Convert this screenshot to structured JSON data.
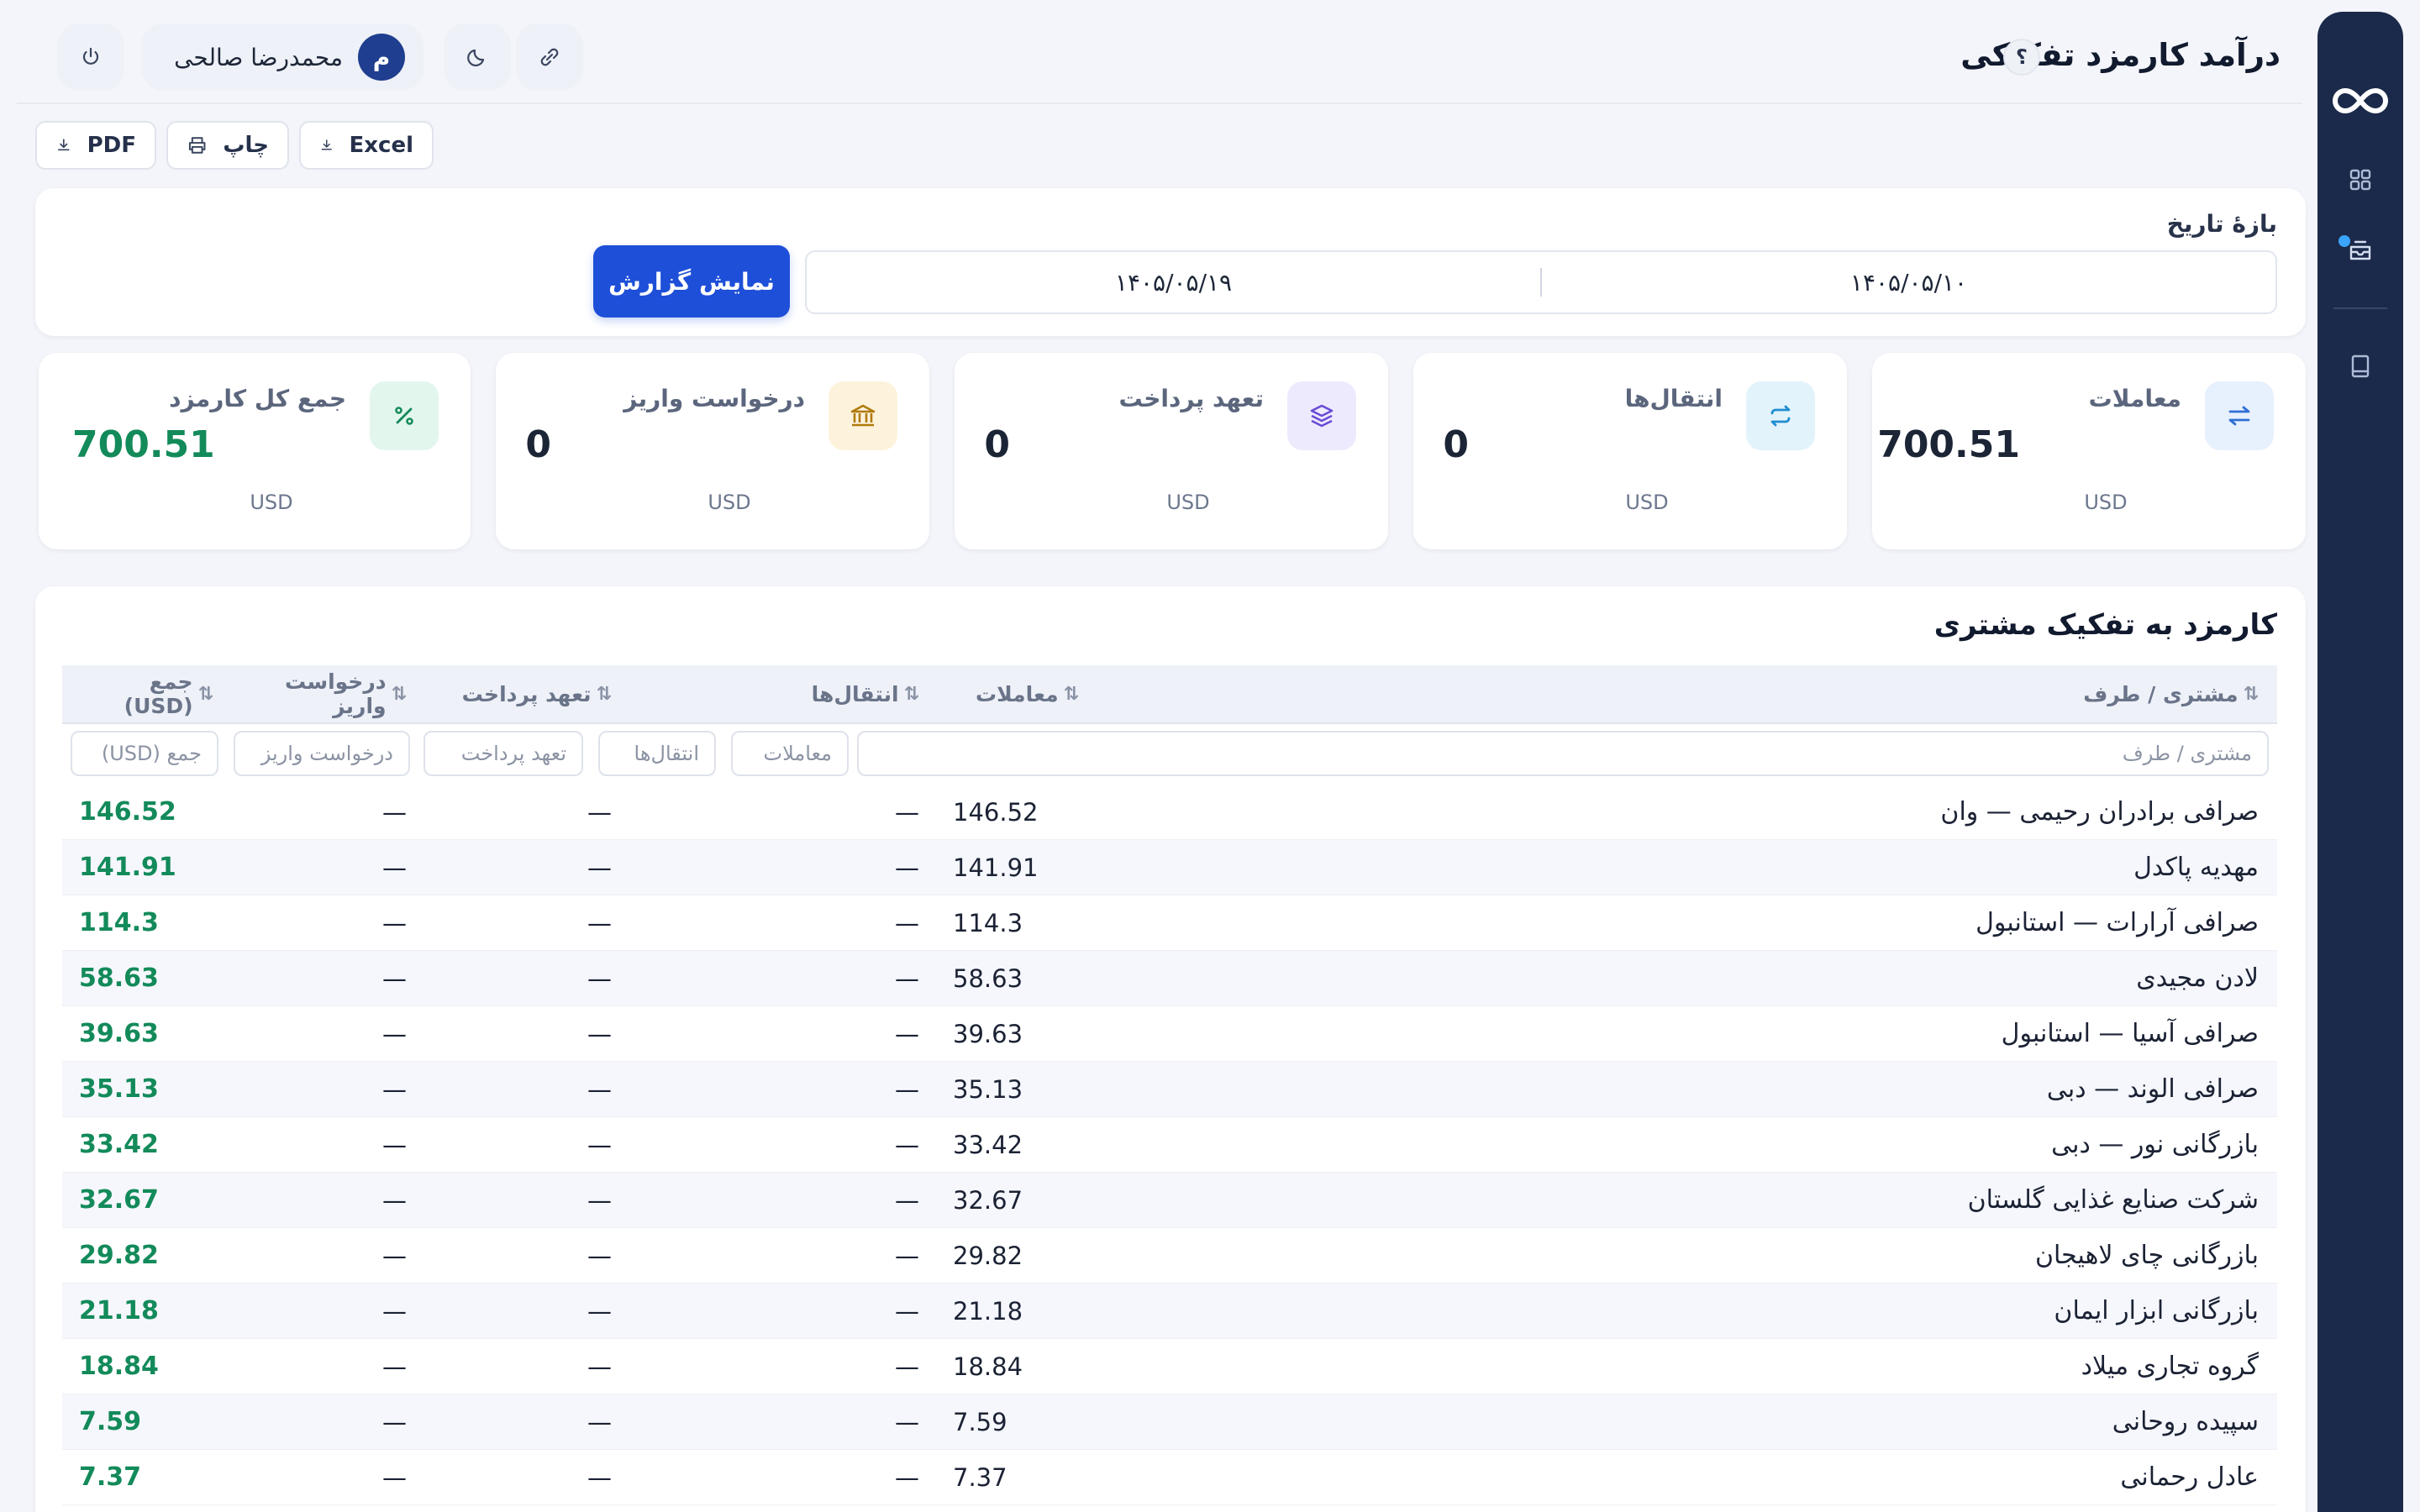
{
  "header": {
    "title": "درآمد کارمزد تفکیکی",
    "help_glyph": "؟",
    "user_initial": "م",
    "user_name": "محمدرضا صالحی"
  },
  "exports": {
    "excel": "Excel",
    "print": "چاپ",
    "pdf": "PDF"
  },
  "filter": {
    "label": "بازهٔ تاریخ",
    "date_from": "۱۴۰۵/۰۵/۱۰",
    "date_to": "۱۴۰۵/۰۵/۱۹",
    "submit_label": "نمایش گزارش"
  },
  "stats": [
    {
      "label": "معاملات",
      "value": "700.51",
      "unit": "USD",
      "icon": "swap-arrows-icon",
      "color": "#2f6fd6",
      "bg": "#e7f0fd"
    },
    {
      "label": "انتقال‌ها",
      "value": "0",
      "unit": "USD",
      "icon": "refresh-arrows-icon",
      "color": "#1f8ed0",
      "bg": "#e3f3fc"
    },
    {
      "label": "تعهد پرداخت",
      "value": "0",
      "unit": "USD",
      "icon": "layers-icon",
      "color": "#6a4bd6",
      "bg": "#eeeafd"
    },
    {
      "label": "درخواست واریز",
      "value": "0",
      "unit": "USD",
      "icon": "bank-icon",
      "color": "#b07a0b",
      "bg": "#fdf3dc"
    },
    {
      "label": "جمع کل کارمزد",
      "value": "700.51",
      "unit": "USD",
      "icon": "percent-icon",
      "color": "#138a5a",
      "bg": "#e2f6ed"
    }
  ],
  "table": {
    "title": "کارمزد به تفکیک مشتری",
    "columns": {
      "name": "مشتری / طرف",
      "transactions": "معاملات",
      "transfers": "انتقال‌ها",
      "commitments": "تعهد پرداخت",
      "deposits": "درخواست واریز",
      "total": "جمع (USD)"
    },
    "sort_glyph": "⇅",
    "filter_placeholders": {
      "name": "مشتری / طرف",
      "transactions": "معاملات",
      "transfers": "انتقال‌ها",
      "commitments": "تعهد پرداخت",
      "deposits": "درخواست واریز",
      "total": "جمع (USD)"
    },
    "rows": [
      {
        "name": "صرافی برادران رحیمی — وان",
        "transactions": "146.52",
        "transfers": "—",
        "commitments": "—",
        "deposits": "—",
        "total": "146.52"
      },
      {
        "name": "مهدیه پاکدل",
        "transactions": "141.91",
        "transfers": "—",
        "commitments": "—",
        "deposits": "—",
        "total": "141.91"
      },
      {
        "name": "صرافی آرارات — استانبول",
        "transactions": "114.3",
        "transfers": "—",
        "commitments": "—",
        "deposits": "—",
        "total": "114.3"
      },
      {
        "name": "لادن مجیدی",
        "transactions": "58.63",
        "transfers": "—",
        "commitments": "—",
        "deposits": "—",
        "total": "58.63"
      },
      {
        "name": "صرافی آسیا — استانبول",
        "transactions": "39.63",
        "transfers": "—",
        "commitments": "—",
        "deposits": "—",
        "total": "39.63"
      },
      {
        "name": "صرافی الوند — دبی",
        "transactions": "35.13",
        "transfers": "—",
        "commitments": "—",
        "deposits": "—",
        "total": "35.13"
      },
      {
        "name": "بازرگانی نور — دبی",
        "transactions": "33.42",
        "transfers": "—",
        "commitments": "—",
        "deposits": "—",
        "total": "33.42"
      },
      {
        "name": "شرکت صنایع غذایی گلستان",
        "transactions": "32.67",
        "transfers": "—",
        "commitments": "—",
        "deposits": "—",
        "total": "32.67"
      },
      {
        "name": "بازرگانی چای لاهیجان",
        "transactions": "29.82",
        "transfers": "—",
        "commitments": "—",
        "deposits": "—",
        "total": "29.82"
      },
      {
        "name": "بازرگانی ابزار ایمان",
        "transactions": "21.18",
        "transfers": "—",
        "commitments": "—",
        "deposits": "—",
        "total": "21.18"
      },
      {
        "name": "گروه تجاری میلاد",
        "transactions": "18.84",
        "transfers": "—",
        "commitments": "—",
        "deposits": "—",
        "total": "18.84"
      },
      {
        "name": "سپیده روحانی",
        "transactions": "7.59",
        "transfers": "—",
        "commitments": "—",
        "deposits": "—",
        "total": "7.59"
      },
      {
        "name": "عادل رحمانی",
        "transactions": "7.37",
        "transfers": "—",
        "commitments": "—",
        "deposits": "—",
        "total": "7.37"
      }
    ]
  }
}
